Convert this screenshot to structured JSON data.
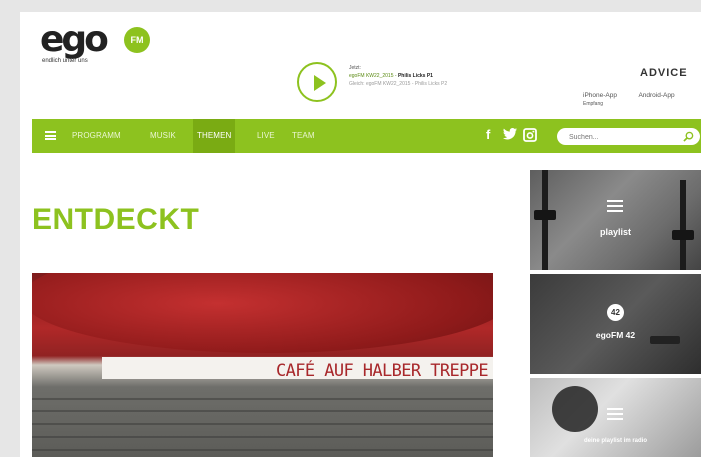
{
  "logo": {
    "text": "ego",
    "fm": "FM",
    "tagline": "endlich unter uns"
  },
  "player": {
    "now_label": "Jetzt:",
    "current_show": "egoFM KW22_2015",
    "current_artist": "Philis Licks P1",
    "next_label": "Gleich:",
    "next_show": "egoFM KW22_2015 - Philis Licks P2"
  },
  "header": {
    "advice": "ADVICE",
    "iphone_app": "iPhone-App",
    "iphone_sub": "Empfang",
    "android_app": "Android-App"
  },
  "nav": {
    "items": [
      "PROGRAMM",
      "MUSIK",
      "THEMEN",
      "LIVE",
      "TEAM"
    ],
    "search_placeholder": "Suchen...",
    "social": [
      "f",
      "t",
      "ig"
    ]
  },
  "main": {
    "heading": "ENTDECKT",
    "hero_caption": "CAFÉ AUF HALBER TREPPE"
  },
  "sidebar": {
    "tiles": [
      {
        "label": "playlist"
      },
      {
        "label": "egoFM 42",
        "badge": "42"
      },
      {
        "label": "deine playlist im radio"
      }
    ]
  },
  "colors": {
    "brand_green": "#8dc21f",
    "hero_red": "#a8282b"
  }
}
